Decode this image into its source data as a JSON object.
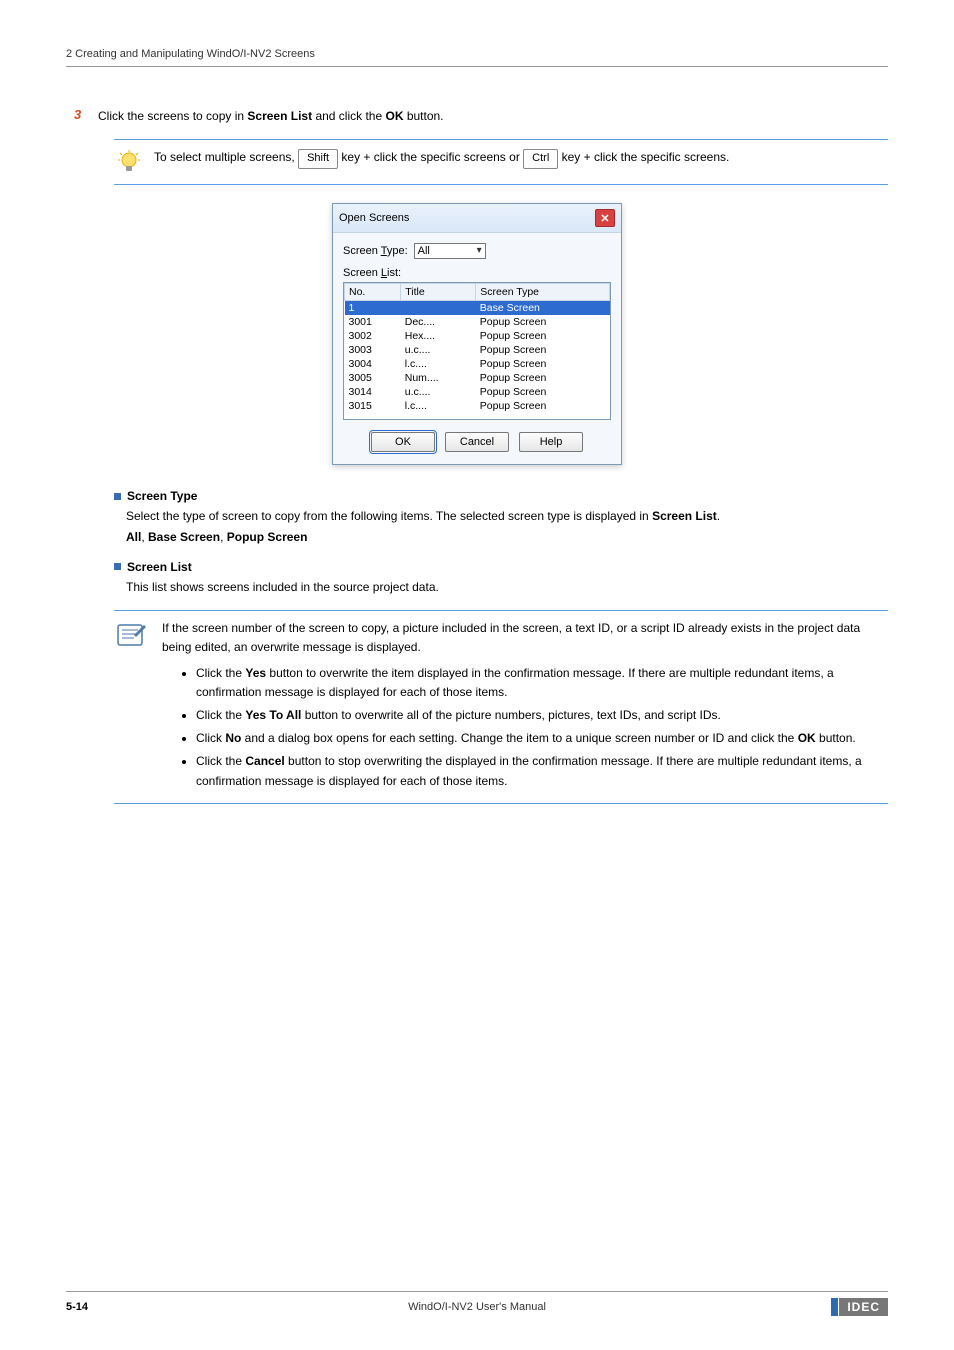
{
  "header": "2 Creating and Manipulating WindO/I-NV2 Screens",
  "step": {
    "num": "3",
    "text_parts": [
      "Click the screens to copy in ",
      " and click the ",
      " button."
    ],
    "bold_parts": [
      "Screen List",
      "OK"
    ]
  },
  "tip": {
    "parts": [
      "To select multiple screens, ",
      " key + click the specific screens or ",
      " key + click the specific screens."
    ],
    "keys": [
      "Shift",
      "Ctrl"
    ]
  },
  "dialog": {
    "title": "Open Screens",
    "type_label": "Screen Type:",
    "type_underline_index": 7,
    "type_value": "All",
    "list_label": "Screen List:",
    "list_underline_index": 7,
    "columns": [
      "No.",
      "Title",
      "Screen Type"
    ],
    "rows": [
      {
        "no": "1",
        "title": "",
        "type": "Base Screen",
        "selected": true
      },
      {
        "no": "3001",
        "title": "Dec....",
        "type": "Popup Screen"
      },
      {
        "no": "3002",
        "title": "Hex....",
        "type": "Popup Screen"
      },
      {
        "no": "3003",
        "title": "u.c....",
        "type": "Popup Screen"
      },
      {
        "no": "3004",
        "title": "l.c....",
        "type": "Popup Screen"
      },
      {
        "no": "3005",
        "title": "Num....",
        "type": "Popup Screen"
      },
      {
        "no": "3014",
        "title": "u.c....",
        "type": "Popup Screen"
      },
      {
        "no": "3015",
        "title": "l.c....",
        "type": "Popup Screen"
      }
    ],
    "buttons": {
      "ok": "OK",
      "cancel": "Cancel",
      "help": "Help"
    }
  },
  "section_screen_type": {
    "heading": "Screen Type",
    "desc_parts": [
      "Select the type of screen to copy from the following items. The selected screen type is displayed in ",
      "."
    ],
    "desc_bold": "Screen List",
    "options": [
      "All",
      "Base Screen",
      "Popup Screen"
    ]
  },
  "section_screen_list": {
    "heading": "Screen List",
    "desc": "This list shows screens included in the source project data."
  },
  "note": {
    "intro": "If the screen number of the screen to copy, a picture included in the screen, a text ID, or a script ID already exists in the project data being edited, an overwrite message is displayed.",
    "bullets": [
      {
        "pre": "Click the ",
        "b": "Yes",
        "post": " button to overwrite the item displayed in the confirmation message. If there are multiple redundant items, a confirmation message is displayed for each of those items."
      },
      {
        "pre": "Click the ",
        "b": "Yes To All",
        "post": " button to overwrite all of the picture numbers, pictures, text IDs, and script IDs."
      },
      {
        "pre": "Click ",
        "b": "No",
        "post": " and a dialog box opens for each setting. Change the item to a unique screen number or ID and click the ",
        "b2": "OK",
        "post2": " button."
      },
      {
        "pre": "Click the ",
        "b": "Cancel",
        "post": " button to stop overwriting the displayed in the confirmation message. If there are multiple redundant items, a confirmation message is displayed for each of those items."
      }
    ]
  },
  "footer": {
    "page": "5-14",
    "manual": "WindO/I-NV2 User's Manual",
    "brand": "IDEC"
  }
}
